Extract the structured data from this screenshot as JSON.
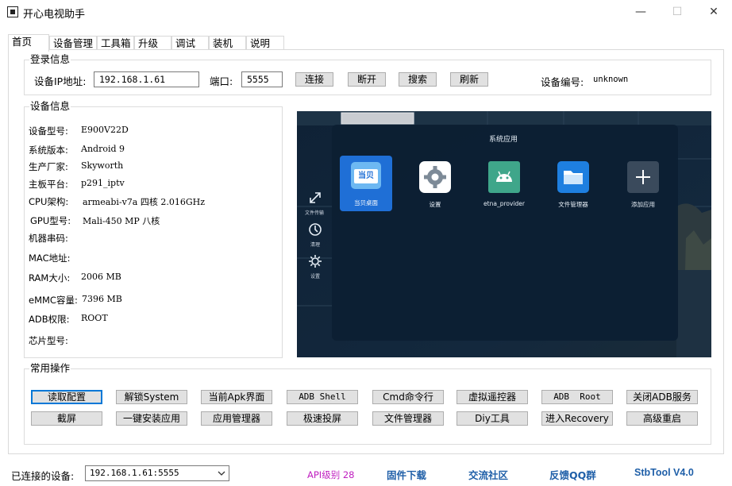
{
  "window": {
    "title": "开心电视助手",
    "controls": [
      "—",
      "☐",
      "✕"
    ]
  },
  "tabs": [
    "首页",
    "设备管理",
    "工具箱",
    "升级",
    "调试",
    "装机",
    "说明"
  ],
  "login": {
    "legend": "登录信息",
    "ip_label": "设备IP地址:",
    "ip_value": "192.168.1.61",
    "port_label": "端口:",
    "port_value": "5555",
    "connect": "连接",
    "disconnect": "断开",
    "search": "搜索",
    "refresh": "刷新",
    "device_id_label": "设备编号:",
    "device_id_value": "unknown"
  },
  "device_info": {
    "legend": "设备信息",
    "rows": [
      {
        "label": "设备型号:",
        "value": "E900V22D"
      },
      {
        "label": "系统版本:",
        "value": "Android 9"
      },
      {
        "label": "生产厂家:",
        "value": "Skyworth"
      },
      {
        "label": "主板平台:",
        "value": "p291_iptv"
      },
      {
        "label": "CPU架构:",
        "value": "armeabi-v7a 四核 2.016GHz"
      },
      {
        "label": "GPU型号:",
        "value": "Mali-450 MP 八核"
      },
      {
        "label": "机器串码:",
        "value": ""
      },
      {
        "label": "MAC地址:",
        "value": ""
      },
      {
        "label": "RAM大小:",
        "value": "2006 MB"
      },
      {
        "label": "eMMC容量:",
        "value": "7396 MB"
      },
      {
        "label": "ADB权限:",
        "value": "ROOT"
      },
      {
        "label": "芯片型号:",
        "value": ""
      }
    ]
  },
  "tv_screen": {
    "panel_title": "系统应用",
    "side_items": [
      {
        "label": "文件传输",
        "icon": "transfer-icon"
      },
      {
        "label": "清理",
        "icon": "clean-icon"
      },
      {
        "label": "设置",
        "icon": "gear-icon"
      }
    ],
    "apps": [
      {
        "label": "当贝桌面",
        "icon": "dangbei-icon",
        "selected": true
      },
      {
        "label": "设置",
        "icon": "settings-app-icon"
      },
      {
        "label": "etna_provider",
        "icon": "android-icon"
      },
      {
        "label": "文件管理器",
        "icon": "folder-icon"
      },
      {
        "label": "添加应用",
        "icon": "plus-icon"
      }
    ],
    "dangbei_badge": "当贝"
  },
  "ops": {
    "legend": "常用操作",
    "row1": [
      "读取配置",
      "解锁System",
      "当前Apk界面",
      "ADB Shell",
      "Cmd命令行",
      "虚拟遥控器",
      "ADB  Root",
      "关闭ADB服务"
    ],
    "row2": [
      "截屏",
      "一键安装应用",
      "应用管理器",
      "极速投屏",
      "文件管理器",
      "Diy工具",
      "进入Recovery",
      "高级重启"
    ]
  },
  "footer": {
    "connected_label": "已连接的设备:",
    "connected_value": "192.168.1.61:5555",
    "api_level": "API级别 28",
    "firmware_link": "固件下载",
    "community_link": "交流社区",
    "feedback_link": "反馈QQ群",
    "version": "StbTool V4.0"
  },
  "colors": {
    "accent": "#0078d7",
    "api_level": "#c020c0",
    "link": "#1f5fa8",
    "tv_background": "#0d1b2b"
  }
}
